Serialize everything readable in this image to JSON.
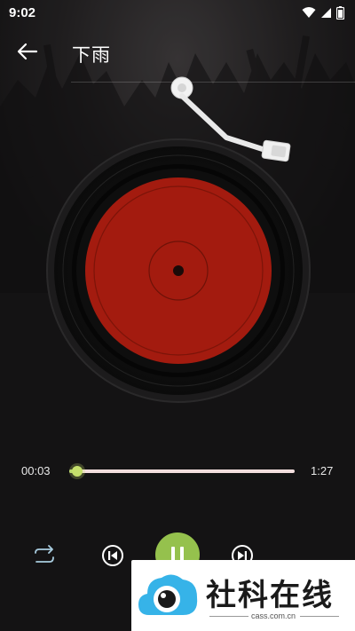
{
  "status_bar": {
    "time": "9:02",
    "icons": [
      "wifi-icon",
      "signal-icon",
      "battery-icon"
    ]
  },
  "header": {
    "back_icon": "arrow-left-icon",
    "title": "下雨"
  },
  "player": {
    "disc_color": "#a31b0f",
    "current_time": "00:03",
    "total_time": "1:27",
    "progress": 0.035,
    "accent_color": "#95c14d",
    "controls": {
      "repeat_icon": "repeat-icon",
      "prev_icon": "skip-previous-icon",
      "play_pause_icon": "pause-icon",
      "next_icon": "skip-next-icon"
    }
  },
  "watermark": {
    "logo_icon": "cloud-eye-logo-icon",
    "text": "社科在线",
    "sub_text": "cass.com.cn"
  }
}
